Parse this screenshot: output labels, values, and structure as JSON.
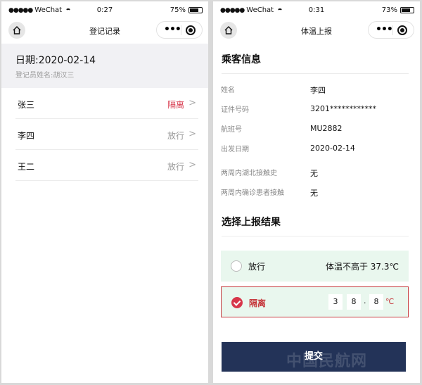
{
  "status_left": {
    "signal": "●●●●●",
    "carrier": "WeChat",
    "time": "0:27",
    "battery": "75%",
    "battery_level": 0.75
  },
  "status_right": {
    "signal": "●●●●●",
    "carrier": "WeChat",
    "time": "0:31",
    "battery": "73%",
    "battery_level": 0.73
  },
  "left_screen": {
    "title": "登记记录",
    "date": "日期:2020-02-14",
    "registrar": "登记员姓名:胡汉三",
    "records": [
      {
        "name": "张三",
        "status": "隔离",
        "status_color": "#d7364a"
      },
      {
        "name": "李四",
        "status": "放行",
        "status_color": "#999999"
      },
      {
        "name": "王二",
        "status": "放行",
        "status_color": "#999999"
      }
    ]
  },
  "right_screen": {
    "title": "体温上报",
    "passenger_section": "乘客信息",
    "info": [
      {
        "label": "姓名",
        "value": "李四"
      },
      {
        "label": "证件号码",
        "value": "3201************"
      },
      {
        "label": "航班号",
        "value": "MU2882"
      },
      {
        "label": "出发日期",
        "value": "2020-02-14"
      },
      {
        "label": "两周内湖北接触史",
        "value": "无"
      },
      {
        "label": "两周内确诊患者接触",
        "value": "无"
      }
    ],
    "result_section": "选择上报结果",
    "option_pass": {
      "label": "放行",
      "desc": "体温不高于 37.3℃"
    },
    "option_quarantine": {
      "label": "隔离",
      "digits": [
        "3",
        "8",
        "8"
      ],
      "dot": ".",
      "unit": "℃"
    },
    "submit": "提交",
    "watermark": "中国民航网"
  },
  "icons": {
    "home": "home-icon",
    "more": "more-dots-icon",
    "close": "target-circle-icon",
    "chevron": "chevron-right-icon"
  },
  "colors": {
    "accent_red": "#d7364a",
    "submit_bg": "#233358",
    "option_bg": "#e9f7ee"
  }
}
